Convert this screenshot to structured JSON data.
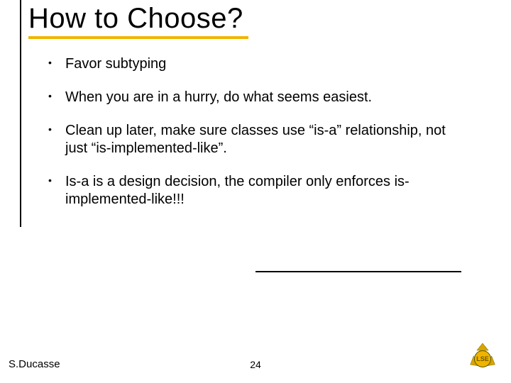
{
  "title": "How to Choose?",
  "bullets": [
    "Favor subtyping",
    "When you are in a hurry, do what seems easiest.",
    "Clean up later, make sure classes use “is-a” relationship, not just “is-implemented-like”.",
    "Is-a is a design decision, the compiler only enforces is-implemented-like!!!"
  ],
  "footer": {
    "author": "S.Ducasse",
    "page": "24",
    "logo_text": "LSE"
  },
  "colors": {
    "accent": "#f0b400"
  }
}
